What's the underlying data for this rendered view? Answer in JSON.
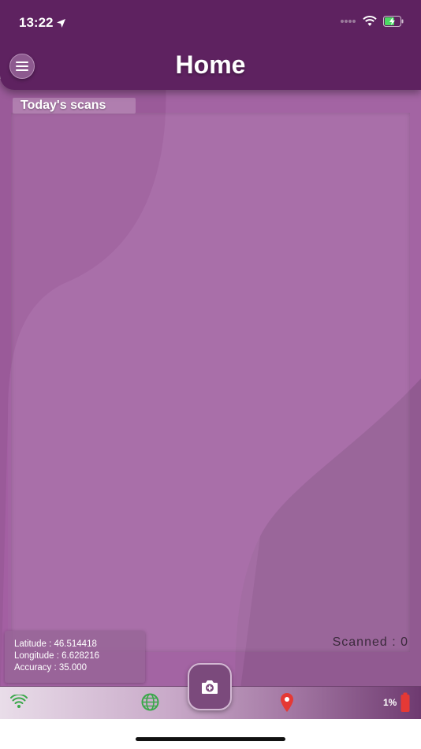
{
  "status_bar": {
    "time": "13:22"
  },
  "header": {
    "title": "Home"
  },
  "scans": {
    "label": "Today's scans",
    "scanned_text": "Scanned : 0"
  },
  "location": {
    "latitude": "Latitude : 46.514418",
    "longitude": "Longitude : 6.628216",
    "accuracy": "Accuracy : 35.000"
  },
  "bottom_bar": {
    "battery_percent": "1%"
  },
  "icons": {
    "menu": "hamburger-menu-icon",
    "camera": "camera-plus-icon",
    "wifi": "wifi-icon",
    "globe": "globe-icon",
    "location": "location-pin-icon",
    "battery": "battery-low-icon"
  },
  "colors": {
    "header": "#5e2260",
    "background": "#a35fa2",
    "wifi_icon": "#3aa84a",
    "globe_icon": "#3aa84a",
    "pin_icon": "#e53935",
    "battery_icon": "#e53935"
  }
}
